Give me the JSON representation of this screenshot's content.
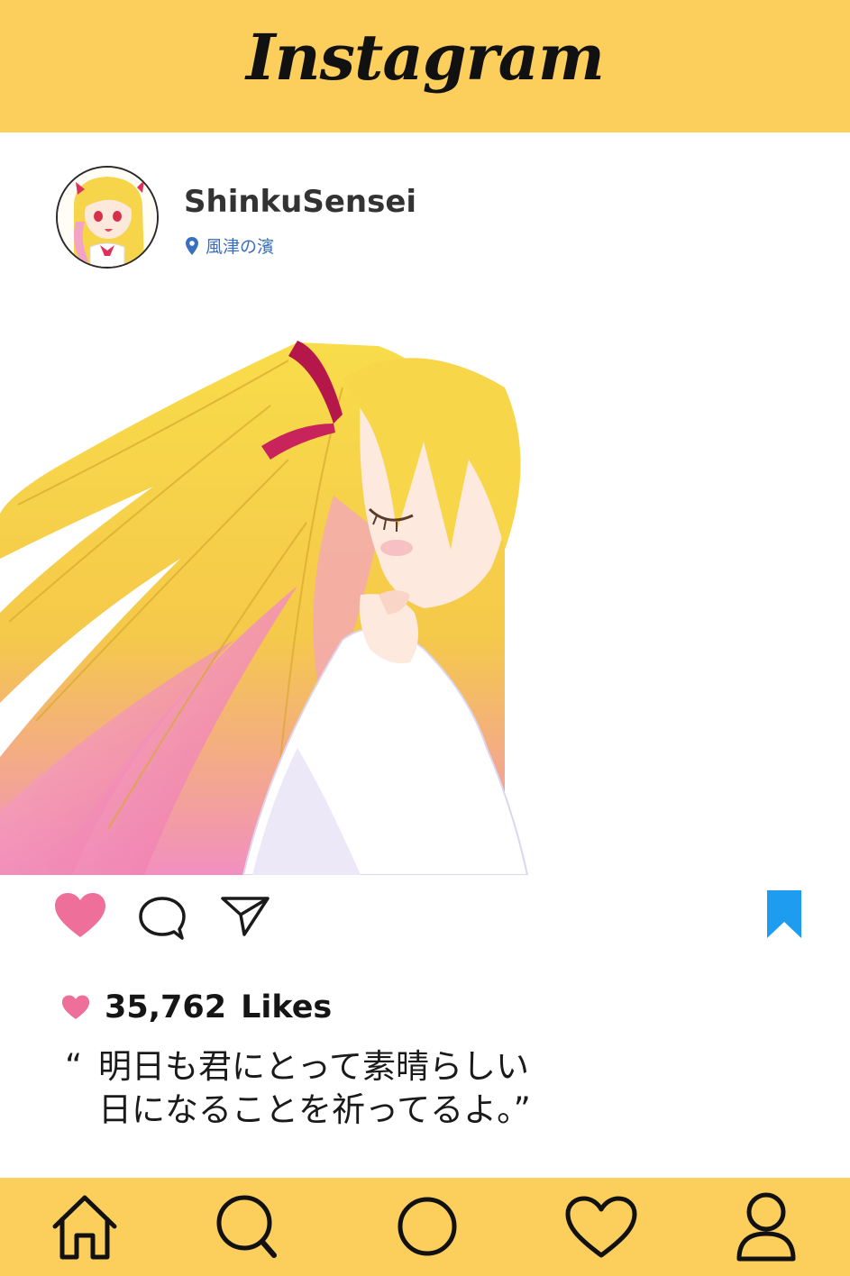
{
  "header": {
    "logo_text": "Instagram"
  },
  "post": {
    "username": "ShinkuSensei",
    "location": "風津の濱",
    "likes_count": "35,762",
    "likes_label": "Likes",
    "caption_open_quote": "“",
    "caption_line1": "明日も君にとって素晴らしい",
    "caption_line2": "日になることを祈ってるよ。”"
  },
  "icons": {
    "like": "heart-icon",
    "comment": "comment-bubble-icon",
    "share": "paper-plane-icon",
    "save": "bookmark-icon",
    "location": "map-pin-icon",
    "likes_heart": "small-heart-icon",
    "nav": [
      "home-icon",
      "search-icon",
      "circle-icon",
      "heart-icon",
      "profile-icon"
    ]
  },
  "colors": {
    "bar_yellow": "#fccf5c",
    "like_pink": "#ef6f9b",
    "bookmark_blue": "#1e9cf0",
    "location_blue": "#3a6fbf"
  }
}
